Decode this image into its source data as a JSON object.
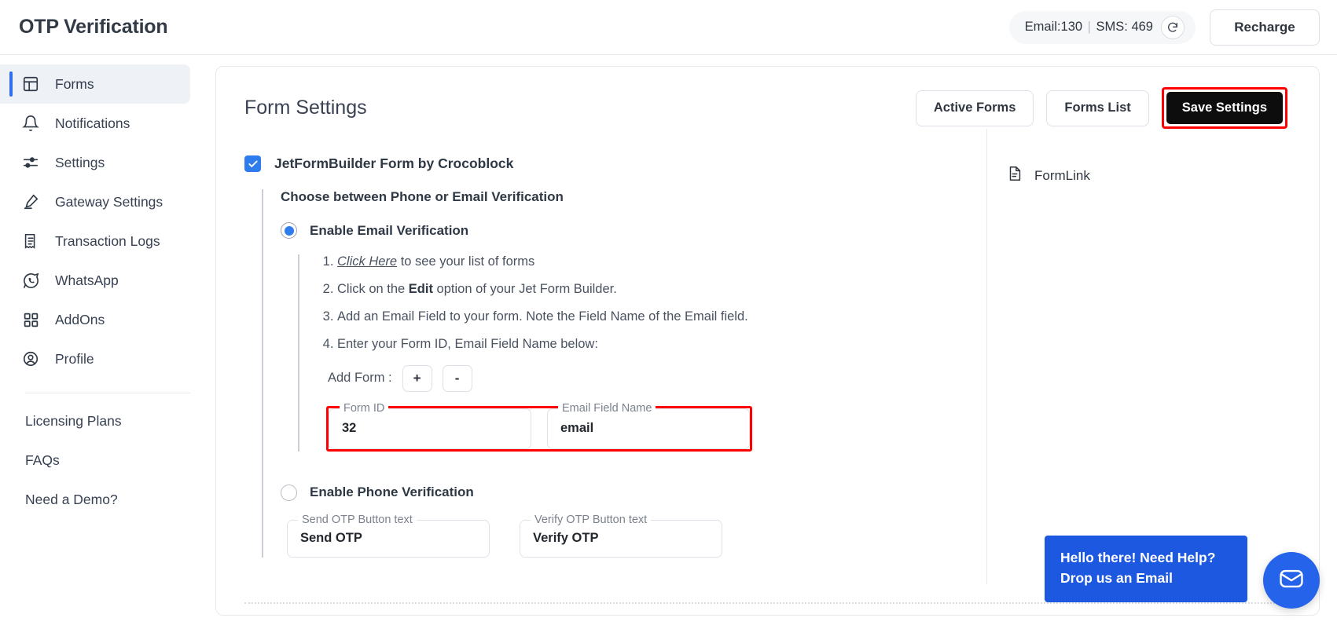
{
  "header": {
    "app_title": "OTP Verification",
    "credits_email": "Email:130",
    "credits_sep": "|",
    "credits_sms": "SMS: 469",
    "refresh_icon": "refresh-icon",
    "recharge_label": "Recharge"
  },
  "sidebar": {
    "items": [
      {
        "label": "Forms",
        "icon": "forms-layout-icon",
        "active": true
      },
      {
        "label": "Notifications",
        "icon": "bell-icon",
        "active": false
      },
      {
        "label": "Settings",
        "icon": "sliders-icon",
        "active": false
      },
      {
        "label": "Gateway Settings",
        "icon": "pen-icon",
        "active": false
      },
      {
        "label": "Transaction Logs",
        "icon": "receipt-icon",
        "active": false
      },
      {
        "label": "WhatsApp",
        "icon": "whatsapp-icon",
        "active": false
      },
      {
        "label": "AddOns",
        "icon": "grid-squares-icon",
        "active": false
      },
      {
        "label": "Profile",
        "icon": "user-circle-icon",
        "active": false
      }
    ],
    "plain_items": [
      {
        "label": "Licensing Plans"
      },
      {
        "label": "FAQs"
      },
      {
        "label": "Need a Demo?"
      }
    ]
  },
  "main": {
    "page_title": "Form Settings",
    "buttons": {
      "active_forms": "Active Forms",
      "forms_list": "Forms List",
      "save_settings": "Save Settings"
    },
    "form_checkbox": {
      "label": "JetFormBuilder Form by Crocoblock",
      "checked": true
    },
    "section_heading": "Choose between Phone or Email Verification",
    "email_option": {
      "label": "Enable Email Verification",
      "selected": true
    },
    "steps": {
      "step1_link": "Click Here",
      "step1_rest": " to see your list of forms",
      "step2_pre": "Click on the ",
      "step2_bold": "Edit",
      "step2_post": " option of your Jet Form Builder.",
      "step3": "Add an Email Field to your form. Note the Field Name of the Email field.",
      "step4": "Enter your Form ID, Email Field Name below:"
    },
    "add_form": {
      "label": "Add Form :",
      "plus": "+",
      "minus": "-"
    },
    "email_fields": [
      {
        "legend": "Form ID",
        "value": "32"
      },
      {
        "legend": "Email Field Name",
        "value": "email"
      }
    ],
    "phone_option": {
      "label": "Enable Phone Verification",
      "selected": false
    },
    "otp_fields": [
      {
        "legend": "Send OTP Button text",
        "value": "Send OTP"
      },
      {
        "legend": "Verify OTP Button text",
        "value": "Verify OTP"
      }
    ],
    "right_panel": {
      "formlink_label": "FormLink",
      "formlink_icon": "document-icon"
    }
  },
  "chat_widget": {
    "line1": "Hello there! Need Help?",
    "line2": "Drop us an Email",
    "fab_icon": "chat-envelope-icon"
  },
  "colors": {
    "accent_blue": "#2f6fed",
    "highlight_red": "#ff0000",
    "dark_button": "#0d0d0d",
    "chat_blue": "#1d58e0"
  }
}
